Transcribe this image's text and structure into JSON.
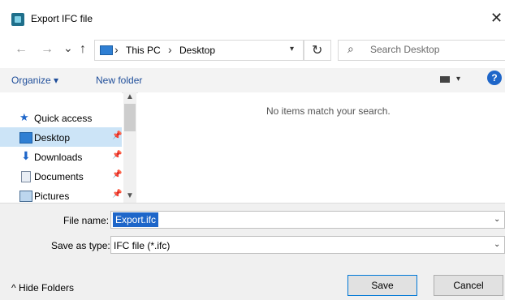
{
  "window": {
    "title": "Export IFC file",
    "close_glyph": "✕"
  },
  "navigation": {
    "back_glyph": "←",
    "forward_glyph": "→",
    "recent_glyph": "⌄",
    "up_glyph": "↑",
    "breadcrumb": [
      "This PC",
      "Desktop"
    ],
    "refresh_glyph": "↻",
    "search_placeholder": "Search Desktop"
  },
  "toolbar": {
    "organize_label": "Organize ▾",
    "new_folder_label": "New folder",
    "help_label": "?"
  },
  "sidebar": {
    "items": [
      {
        "label": "Quick access",
        "icon": "star-icon"
      },
      {
        "label": "Desktop",
        "icon": "desktop-icon",
        "selected": true
      },
      {
        "label": "Downloads",
        "icon": "download-icon"
      },
      {
        "label": "Documents",
        "icon": "documents-icon"
      },
      {
        "label": "Pictures",
        "icon": "pictures-icon"
      }
    ]
  },
  "content": {
    "empty_message": "No items match your search."
  },
  "form": {
    "file_name_label": "File name:",
    "file_name_value": "Export.ifc",
    "save_type_label": "Save as type:",
    "save_type_value": "IFC file (*.ifc)"
  },
  "footer": {
    "hide_folders_label": "^  Hide Folders",
    "save_label": "Save",
    "cancel_label": "Cancel"
  },
  "colors": {
    "accent": "#1e66c9",
    "selection": "#cce4f7"
  }
}
